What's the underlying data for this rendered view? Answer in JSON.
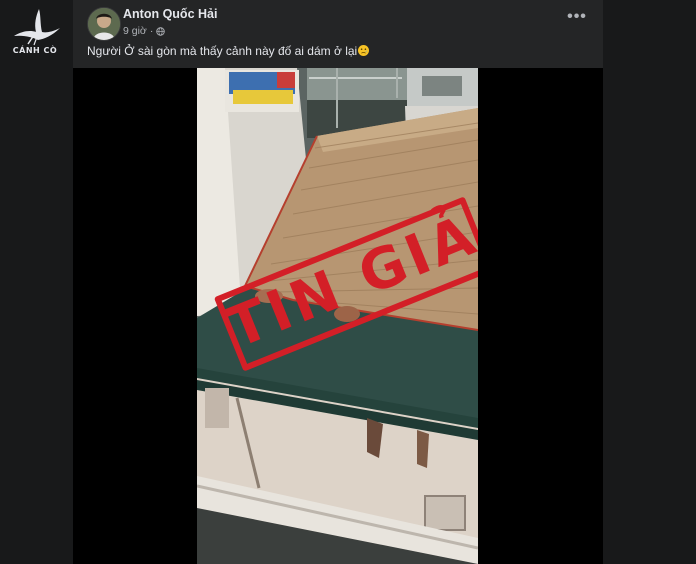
{
  "watermark": {
    "label": "CÁNH CÒ",
    "icon": "crane-bird-icon"
  },
  "post": {
    "author": "Anton Quốc Hải",
    "time": "9 giờ",
    "audience_icon": "globe-icon",
    "more_icon": "ellipsis-icon",
    "more_label": "•••",
    "caption": "Người Ở sài gòn mà thấy cảnh này đố ai dám ở lại",
    "caption_emoji": "crying-face-emoji"
  },
  "video": {
    "stamp_text": "TIN GIẢ",
    "stamp_color": "#d31f27"
  }
}
